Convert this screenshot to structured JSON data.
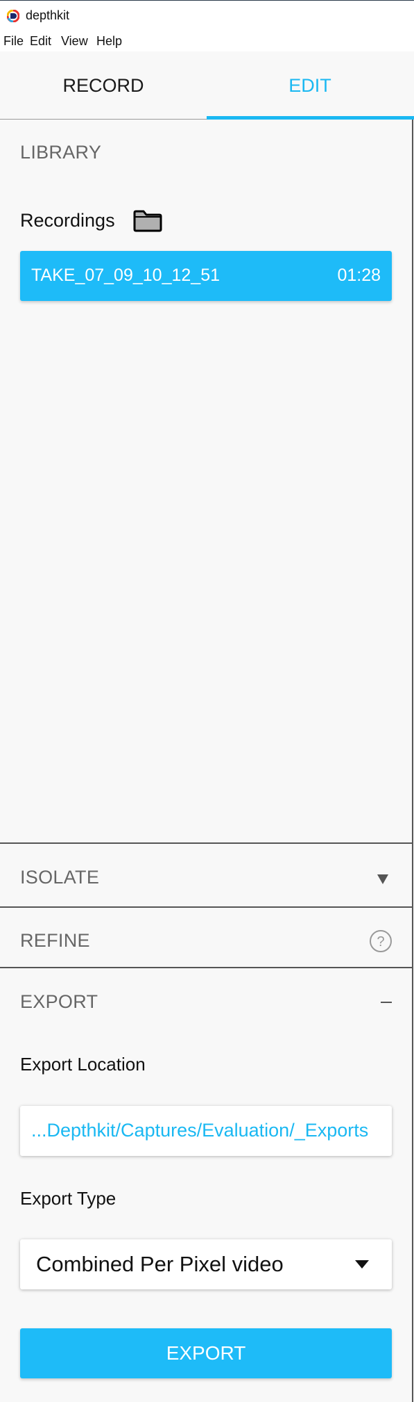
{
  "window": {
    "title": "depthkit",
    "app_icon": "depthkit-logo-icon"
  },
  "menu": {
    "items": [
      "File",
      "Edit",
      "View",
      "Help"
    ]
  },
  "tabs": [
    {
      "label": "RECORD",
      "active": false
    },
    {
      "label": "EDIT",
      "active": true
    }
  ],
  "library": {
    "title": "LIBRARY",
    "recordings_label": "Recordings",
    "folder_icon": "folder-icon",
    "recordings": [
      {
        "name": "TAKE_07_09_10_12_51",
        "duration": "01:28",
        "selected": true
      }
    ]
  },
  "isolate": {
    "title": "ISOLATE",
    "icon": "caret-down-icon"
  },
  "refine": {
    "title": "REFINE",
    "icon": "help-icon",
    "icon_text": "?"
  },
  "export": {
    "title": "EXPORT",
    "collapse_icon": "minus-icon",
    "location_label": "Export Location",
    "location_value": "...Depthkit/Captures/Evaluation/_Exports",
    "type_label": "Export Type",
    "type_value": "Combined Per Pixel video",
    "button_label": "EXPORT"
  },
  "colors": {
    "accent": "#1ab8f2",
    "button": "#1ebbf8",
    "background": "#f8f8f8",
    "section_text": "#666666"
  }
}
